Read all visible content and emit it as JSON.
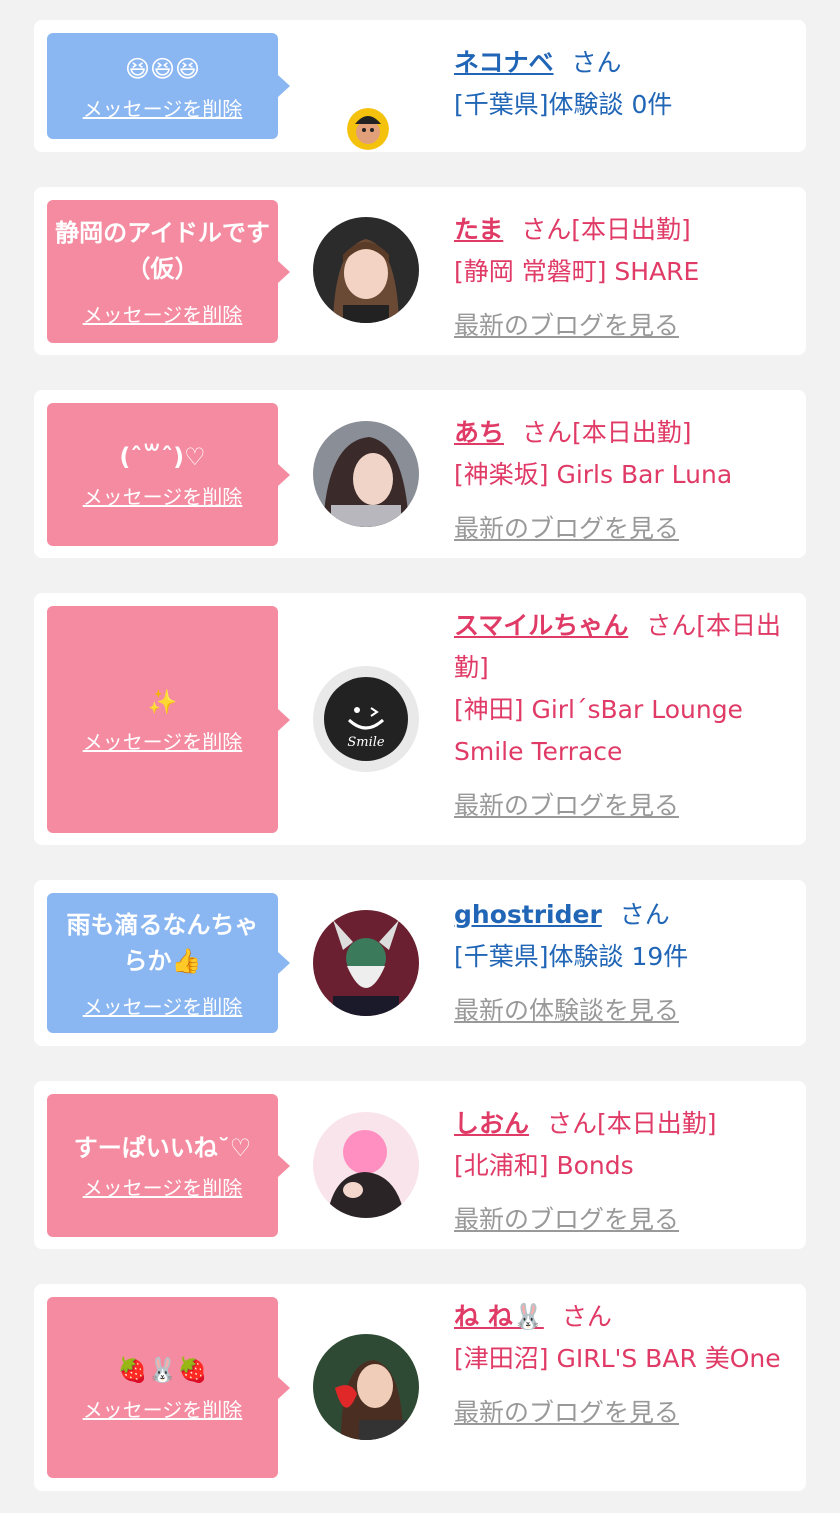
{
  "delete_label": "メッセージを削除",
  "honorific": "さん",
  "colors": {
    "pink_bubble": "#f58ba0",
    "blue_bubble": "#8ab6f2",
    "pink_text": "#e03a66",
    "blue_text": "#2166b6",
    "link_gray": "#999999"
  },
  "cards": [
    {
      "message": "😆😆😆",
      "name": "ネコナベ",
      "status": "",
      "detail": "[千葉県]体験談 0件",
      "link": "",
      "avatar": "user-avatar-cartoon-icon"
    },
    {
      "message": "静岡のアイドルです（仮）",
      "name": "たま",
      "status": "[本日出勤]",
      "detail": "[静岡 常磐町] SHARE",
      "link": "最新のブログを見る",
      "avatar": "girl-photo"
    },
    {
      "message": "(ˆ꒳ˆ)♡",
      "name": "あち",
      "status": "[本日出勤]",
      "detail": "[神楽坂] Girls Bar Luna",
      "link": "最新のブログを見る",
      "avatar": "girl-photo"
    },
    {
      "message": "✨",
      "name": "スマイルちゃん",
      "status": "[本日出勤]",
      "detail": "[神田] Girl´sBar Lounge Smile Terrace",
      "link": "最新のブログを見る",
      "avatar": "smile-logo"
    },
    {
      "message": "雨も滴るなんちゃらか👍",
      "name": "ghostrider",
      "status": "",
      "detail": "[千葉県]体験談 19件",
      "link": "最新の体験談を見る",
      "avatar": "ghost-character-art"
    },
    {
      "message": "すーぱいいね˘♡",
      "name": "しおん",
      "status": "[本日出勤]",
      "detail": "[北浦和] Bonds",
      "link": "最新のブログを見る",
      "avatar": "girl-photo"
    },
    {
      "message": "🍓🐰🍓",
      "name": "ね ね🐰",
      "status": "",
      "detail": "[津田沼] GIRL'S BAR 美One",
      "link": "最新のブログを見る",
      "avatar": "girl-photo-strawberry"
    }
  ]
}
